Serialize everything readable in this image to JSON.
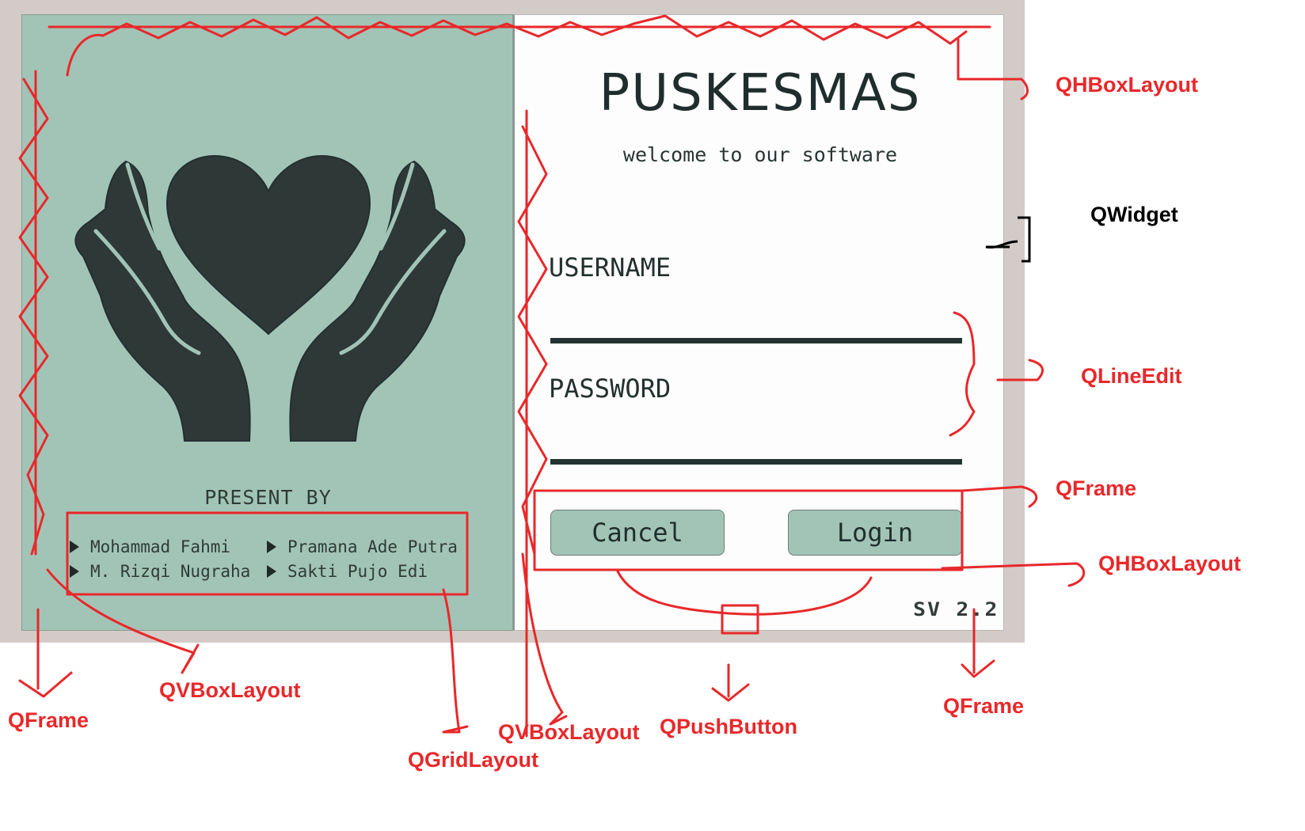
{
  "left_panel": {
    "present_by": "PRESENT BY",
    "authors": [
      "Mohammad Fahmi",
      "Pramana Ade Putra",
      "M. Rizqi Nugraha",
      "Sakti Pujo Edi"
    ]
  },
  "right_panel": {
    "title": "PUSKESMAS",
    "subtitle": "welcome to our software",
    "username_label": "USERNAME",
    "username_value": "",
    "password_label": "PASSWORD",
    "password_value": "",
    "cancel_label": "Cancel",
    "login_label": "Login",
    "version": "SV 2.2"
  },
  "annotations": {
    "top_hbox": "QHBoxLayout",
    "widget": "QWidget",
    "line_edit": "QLineEdit",
    "button_frame": "QFrame",
    "button_hbox": "QHBoxLayout",
    "left_frame": "QFrame",
    "left_vbox": "QVBoxLayout",
    "grid": "QGridLayout",
    "right_vbox": "QVBoxLayout",
    "push_button": "QPushButton",
    "right_frame": "QFrame"
  },
  "colors": {
    "panel_green": "#a2c4b7",
    "dark_ink": "#2e3b38",
    "annotation_red": "#e8282a"
  }
}
